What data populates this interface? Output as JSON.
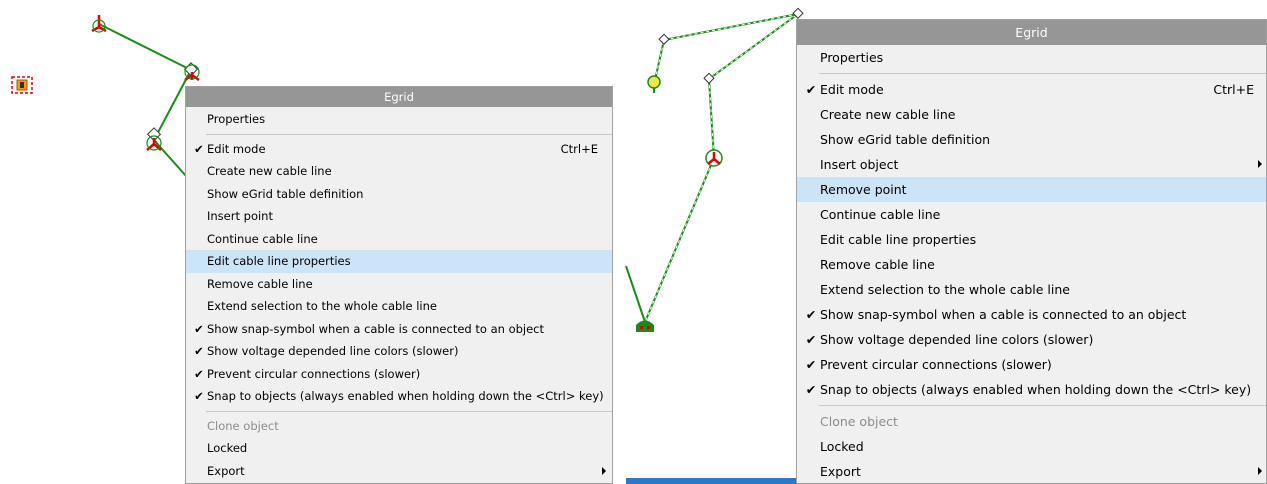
{
  "left_menu": {
    "title": "Egrid",
    "properties": "Properties",
    "edit_mode": "Edit mode",
    "edit_mode_shortcut": "Ctrl+E",
    "create_cable_line": "Create new cable line",
    "show_table_def": "Show eGrid table definition",
    "insert_point": "Insert point",
    "continue_cable_line": "Continue cable line",
    "edit_cable_props": "Edit cable line properties",
    "remove_cable_line": "Remove cable line",
    "extend_selection": "Extend selection to the whole cable line",
    "show_snap_symbol": "Show snap-symbol when a cable is connected to an object",
    "show_voltage_colors": "Show voltage depended line colors (slower)",
    "prevent_circular": "Prevent circular connections (slower)",
    "snap_to_objects": "Snap to objects (always enabled when holding down the <Ctrl> key)",
    "clone_object": "Clone object",
    "locked": "Locked",
    "export": "Export"
  },
  "right_menu": {
    "title": "Egrid",
    "properties": "Properties",
    "edit_mode": "Edit mode",
    "edit_mode_shortcut": "Ctrl+E",
    "create_cable_line": "Create new cable line",
    "show_table_def": "Show eGrid table definition",
    "insert_object": "Insert object",
    "remove_point": "Remove point",
    "continue_cable_line": "Continue cable line",
    "edit_cable_props": "Edit cable line properties",
    "remove_cable_line": "Remove cable line",
    "extend_selection": "Extend selection to the whole cable line",
    "show_snap_symbol": "Show snap-symbol when a cable is connected to an object",
    "show_voltage_colors": "Show voltage depended line colors (slower)",
    "prevent_circular": "Prevent circular connections (slower)",
    "snap_to_objects": "Snap to objects (always enabled when holding down the <Ctrl> key)",
    "clone_object": "Clone object",
    "locked": "Locked",
    "export": "Export"
  },
  "colors": {
    "cable_line": "#1a8a1a",
    "node_red": "#dd0000",
    "menu_highlight": "#cce4f7",
    "menu_title_bg": "#969696"
  },
  "icons": {
    "check": "check-icon",
    "submenu": "chevron-right-icon"
  }
}
